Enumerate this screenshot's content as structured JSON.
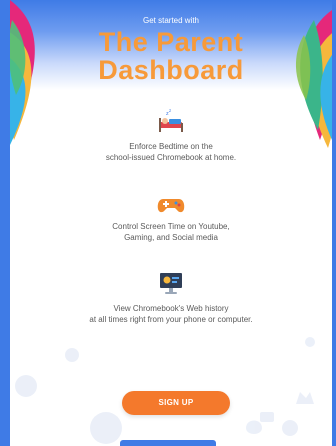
{
  "hero": {
    "eyebrow": "Get started with",
    "title_line1": "The Parent",
    "title_line2": "Dashboard"
  },
  "features": [
    {
      "icon": "bed-icon",
      "line1": "Enforce Bedtime on the",
      "line2": "school-issued Chromebook at home."
    },
    {
      "icon": "gamepad-icon",
      "line1": "Control Screen Time on Youtube,",
      "line2": "Gaming, and Social media"
    },
    {
      "icon": "monitor-icon",
      "line1": "View Chromebook's Web history",
      "line2": "at all times right from your phone or computer."
    }
  ],
  "cta": {
    "label": "SIGN UP"
  },
  "colors": {
    "accent": "#f79a3a",
    "button": "#f4792c",
    "frame": "#3f7be6"
  }
}
